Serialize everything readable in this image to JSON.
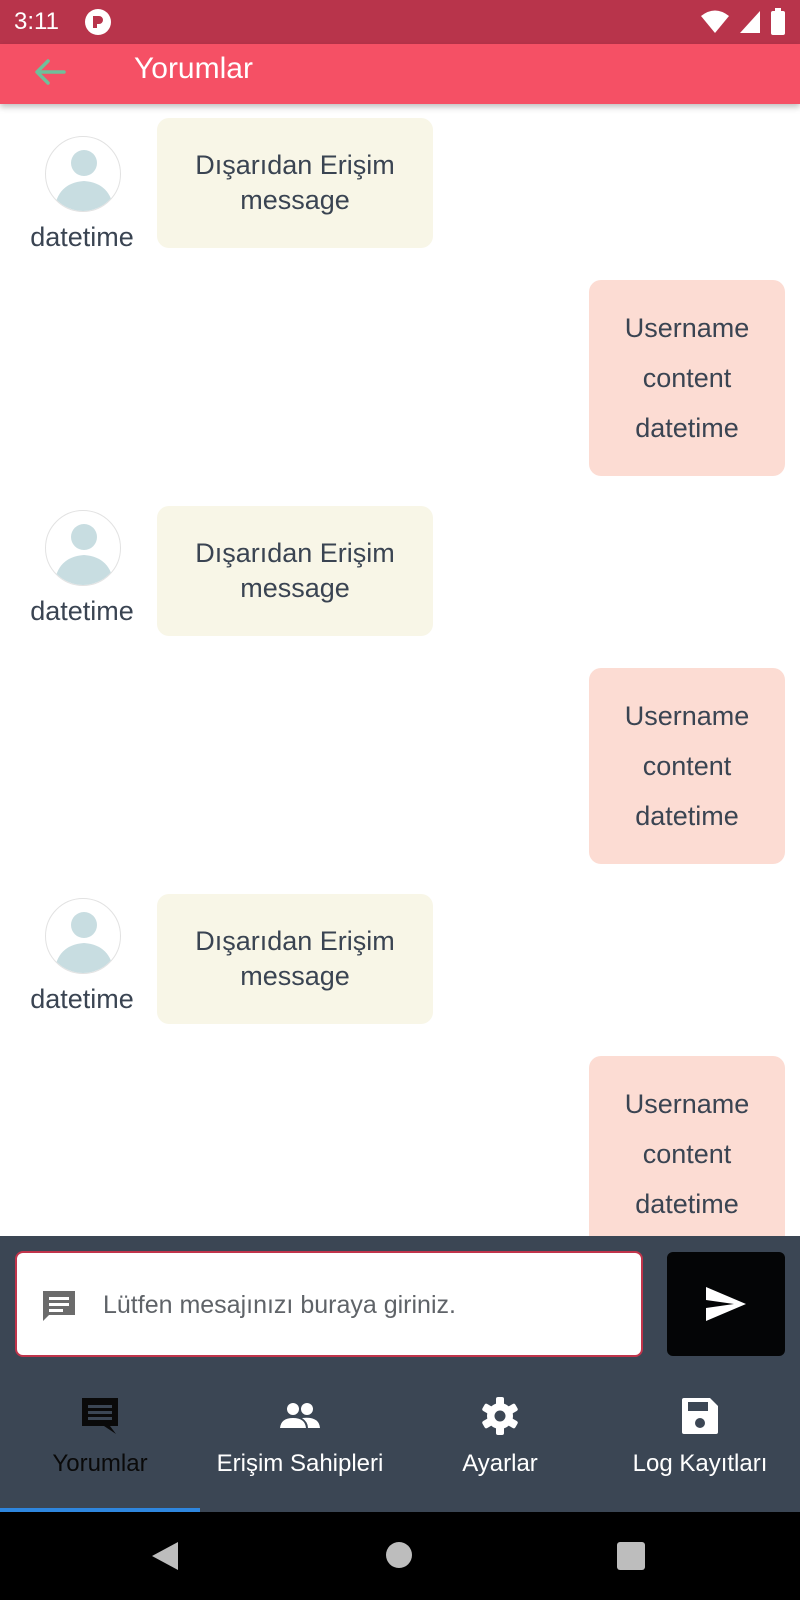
{
  "status_bar": {
    "time": "3:11"
  },
  "app_bar": {
    "title": "Yorumlar"
  },
  "messages": [
    {
      "side": "left",
      "line1": "Dışarıdan Erişim",
      "line2": "message",
      "datetime": "datetime"
    },
    {
      "side": "right",
      "line1": "Username",
      "line2": "content",
      "line3": "datetime"
    },
    {
      "side": "left",
      "line1": "Dışarıdan Erişim",
      "line2": "message",
      "datetime": "datetime"
    },
    {
      "side": "right",
      "line1": "Username",
      "line2": "content",
      "line3": "datetime"
    },
    {
      "side": "left",
      "line1": "Dışarıdan Erişim",
      "line2": "message",
      "datetime": "datetime"
    },
    {
      "side": "right",
      "line1": "Username",
      "line2": "content",
      "line3": "datetime"
    }
  ],
  "composer": {
    "placeholder": "Lütfen mesajınızı buraya giriniz."
  },
  "bottom_nav": {
    "items": [
      {
        "label": "Yorumlar",
        "icon": "comment-icon",
        "active": true
      },
      {
        "label": "Erişim Sahipleri",
        "icon": "people-icon",
        "active": false
      },
      {
        "label": "Ayarlar",
        "icon": "gear-icon",
        "active": false
      },
      {
        "label": "Log Kayıtları",
        "icon": "save-icon",
        "active": false
      }
    ]
  },
  "colors": {
    "status_bar": "#b8344b",
    "app_bar": "#f55065",
    "bubble_left": "#f8f6e7",
    "bubble_right": "#fcdcd3",
    "bottom_panel": "#3b4654",
    "send_button": "#040506",
    "nav_indicator": "#2e86de"
  }
}
